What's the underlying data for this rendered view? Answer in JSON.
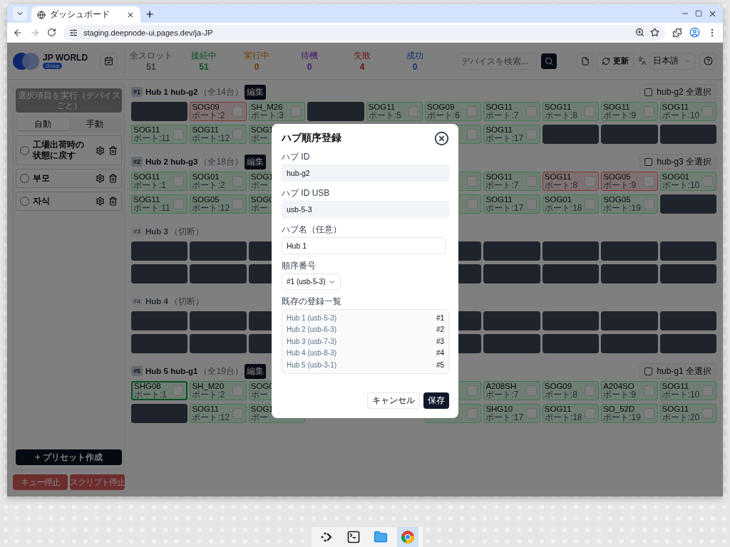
{
  "browser": {
    "tab_title": "ダッシュボード",
    "url": "staging.deepnode-ui.pages.dev/ja-JP"
  },
  "header": {
    "brand": "JP WORLD",
    "brand_badge": "Group",
    "stats": [
      {
        "kind": "total",
        "label": "全スロット",
        "value": "51"
      },
      {
        "kind": "connected",
        "label": "接続中",
        "value": "51"
      },
      {
        "kind": "running",
        "label": "実行中",
        "value": "0"
      },
      {
        "kind": "waiting",
        "label": "待機",
        "value": "0"
      },
      {
        "kind": "failed",
        "label": "失敗",
        "value": "4"
      },
      {
        "kind": "success",
        "label": "成功",
        "value": "0"
      }
    ],
    "search": {
      "placeholder": "デバイスを検索..."
    },
    "refresh": "更新",
    "language": "日本語"
  },
  "sidebar": {
    "run_button": "選択項目を実行（デバイスごと）",
    "modes": [
      {
        "label": "自動",
        "selected": true
      },
      {
        "label": "手動",
        "selected": false
      }
    ],
    "presets": [
      {
        "name": "工場出荷時の状態に戻す",
        "selected": false
      },
      {
        "name": "부모",
        "selected": false
      },
      {
        "name": "자식",
        "selected": false
      }
    ],
    "create_button": "+ プリセット作成",
    "stop_buttons": [
      "キュー停止",
      "スクリプト停止"
    ]
  },
  "hubs": [
    {
      "badge": "#1",
      "title": "Hub 1 hub-g2",
      "note": "（全14台）",
      "connected": true,
      "edit": "編集",
      "select_all": {
        "label": "hub-g2 全選択",
        "checked": false
      },
      "rows": [
        [
          {
            "kind": "empty"
          },
          {
            "kind": "device",
            "failed": true,
            "name": "SOG09",
            "port": "ポート:2",
            "highlighted": false
          },
          {
            "kind": "device",
            "failed": false,
            "name": "SH_M26",
            "port": "ポート:3",
            "highlighted": false
          },
          {
            "kind": "empty"
          },
          {
            "kind": "device",
            "failed": false,
            "name": "SOG11",
            "port": "ポート:5",
            "highlighted": false
          },
          {
            "kind": "device",
            "failed": false,
            "name": "SOG09",
            "port": "ポート:6",
            "highlighted": false
          },
          {
            "kind": "device",
            "failed": false,
            "name": "SOG11",
            "port": "ポート:7",
            "highlighted": false
          },
          {
            "kind": "device",
            "failed": false,
            "name": "SOG11",
            "port": "ポート:8",
            "highlighted": false
          },
          {
            "kind": "device",
            "failed": false,
            "name": "SOG11",
            "port": "ポート:9",
            "highlighted": false
          },
          {
            "kind": "device",
            "failed": false,
            "name": "SOG11",
            "port": "ポート:10",
            "highlighted": false
          }
        ],
        [
          {
            "kind": "device",
            "failed": false,
            "name": "SOG11",
            "port": "ポート:11",
            "highlighted": false
          },
          {
            "kind": "device",
            "failed": false,
            "name": "SOG11",
            "port": "ポート:12",
            "highlighted": false
          },
          {
            "kind": "device_left",
            "failed": false,
            "name": "SOG1",
            "port": "ポー",
            "highlighted": false
          },
          {
            "kind": "covered"
          },
          {
            "kind": "covered"
          },
          {
            "kind": "device",
            "failed": false,
            "highlighted": false
          },
          {
            "kind": "device",
            "failed": false,
            "name": "SOG11",
            "port": "ポート:17",
            "highlighted": false
          },
          {
            "kind": "empty"
          },
          {
            "kind": "empty"
          },
          {
            "kind": "empty"
          }
        ]
      ]
    },
    {
      "badge": "#2",
      "title": "Hub 2 hub-g3",
      "note": "（全18台）",
      "connected": true,
      "edit": "編集",
      "select_all": {
        "label": "hub-g3 全選択",
        "checked": false
      },
      "rows": [
        [
          {
            "kind": "device",
            "failed": false,
            "name": "SOG11",
            "port": "ポート:1",
            "highlighted": false
          },
          {
            "kind": "device",
            "failed": false,
            "name": "SOG01",
            "port": "ポート:2",
            "highlighted": false
          },
          {
            "kind": "device_left",
            "failed": false,
            "name": "SOG1",
            "port": "ポー",
            "highlighted": false
          },
          {
            "kind": "covered"
          },
          {
            "kind": "covered"
          },
          {
            "kind": "device",
            "failed": false,
            "highlighted": false
          },
          {
            "kind": "device",
            "failed": false,
            "name": "SOG11",
            "port": "ポート:7",
            "highlighted": false
          },
          {
            "kind": "device",
            "failed": true,
            "name": "SOG11",
            "port": "ポート:8",
            "highlighted": false
          },
          {
            "kind": "device",
            "failed": true,
            "name": "SOG05",
            "port": "ポート:9",
            "highlighted": false
          },
          {
            "kind": "device",
            "failed": false,
            "name": "SOG01",
            "port": "ポート:10",
            "highlighted": false
          }
        ],
        [
          {
            "kind": "device",
            "failed": false,
            "name": "SOG11",
            "port": "ポート:11",
            "highlighted": false
          },
          {
            "kind": "device",
            "failed": false,
            "name": "SOG05",
            "port": "ポート:12",
            "highlighted": false
          },
          {
            "kind": "device_left",
            "failed": false,
            "name": "SOG0",
            "port": "ポー",
            "highlighted": false
          },
          {
            "kind": "covered"
          },
          {
            "kind": "covered"
          },
          {
            "kind": "device",
            "failed": false,
            "highlighted": false
          },
          {
            "kind": "device",
            "failed": false,
            "name": "SOG11",
            "port": "ポート:17",
            "highlighted": false
          },
          {
            "kind": "device",
            "failed": false,
            "name": "SOG01",
            "port": "ポート:18",
            "highlighted": false
          },
          {
            "kind": "device",
            "failed": false,
            "name": "SOG05",
            "port": "ポート:19",
            "highlighted": false
          },
          {
            "kind": "empty"
          }
        ]
      ]
    },
    {
      "badge": "#3",
      "title": "Hub 3",
      "note": "（切断）",
      "connected": false,
      "rows": [
        [
          {
            "kind": "empty"
          },
          {
            "kind": "empty"
          },
          {
            "kind": "empty"
          },
          {
            "kind": "covered"
          },
          {
            "kind": "covered"
          },
          {
            "kind": "empty"
          },
          {
            "kind": "empty"
          },
          {
            "kind": "empty"
          },
          {
            "kind": "empty"
          },
          {
            "kind": "empty"
          }
        ],
        [
          {
            "kind": "empty"
          },
          {
            "kind": "empty"
          },
          {
            "kind": "empty"
          },
          {
            "kind": "covered"
          },
          {
            "kind": "covered"
          },
          {
            "kind": "empty"
          },
          {
            "kind": "empty"
          },
          {
            "kind": "empty"
          },
          {
            "kind": "empty"
          },
          {
            "kind": "empty"
          }
        ]
      ]
    },
    {
      "badge": "#4",
      "title": "Hub 4",
      "note": "（切断）",
      "connected": false,
      "rows": [
        [
          {
            "kind": "empty"
          },
          {
            "kind": "empty"
          },
          {
            "kind": "empty"
          },
          {
            "kind": "covered"
          },
          {
            "kind": "covered"
          },
          {
            "kind": "empty"
          },
          {
            "kind": "empty"
          },
          {
            "kind": "empty"
          },
          {
            "kind": "empty"
          },
          {
            "kind": "empty"
          }
        ],
        [
          {
            "kind": "empty"
          },
          {
            "kind": "empty"
          },
          {
            "kind": "empty"
          },
          {
            "kind": "covered"
          },
          {
            "kind": "covered"
          },
          {
            "kind": "empty"
          },
          {
            "kind": "empty"
          },
          {
            "kind": "empty"
          },
          {
            "kind": "empty"
          },
          {
            "kind": "empty"
          }
        ]
      ]
    },
    {
      "badge": "#5",
      "title": "Hub 5 hub-g1",
      "note": "（全19台）",
      "connected": true,
      "edit": "編集",
      "select_all": {
        "label": "hub-g1 全選択",
        "checked": false
      },
      "rows": [
        [
          {
            "kind": "device",
            "failed": false,
            "name": "SHG08",
            "port": "ポート:1",
            "highlighted": true
          },
          {
            "kind": "device",
            "failed": false,
            "name": "SH_M20",
            "port": "ポート:2",
            "highlighted": false
          },
          {
            "kind": "device_left",
            "failed": false,
            "name": "SOG0",
            "port": "ポー",
            "highlighted": false
          },
          {
            "kind": "covered"
          },
          {
            "kind": "covered"
          },
          {
            "kind": "device",
            "failed": false,
            "highlighted": false
          },
          {
            "kind": "device",
            "failed": false,
            "name": "A208SH",
            "port": "ポート:7",
            "highlighted": false
          },
          {
            "kind": "device",
            "failed": false,
            "name": "SOG09",
            "port": "ポート:8",
            "highlighted": false
          },
          {
            "kind": "device",
            "failed": false,
            "name": "A204SO",
            "port": "ポート:9",
            "highlighted": false
          },
          {
            "kind": "device",
            "failed": false,
            "name": "SOG11",
            "port": "ポート:10",
            "highlighted": false
          }
        ],
        [
          {
            "kind": "empty"
          },
          {
            "kind": "device",
            "failed": false,
            "name": "SOG11",
            "port": "ポート:12",
            "highlighted": false
          },
          {
            "kind": "device_left",
            "failed": false,
            "name": "SOG1",
            "port": "ポー",
            "highlighted": false
          },
          {
            "kind": "covered"
          },
          {
            "kind": "covered"
          },
          {
            "kind": "device",
            "failed": false,
            "highlighted": false
          },
          {
            "kind": "device",
            "failed": false,
            "name": "SHG10",
            "port": "ポート:17",
            "highlighted": false
          },
          {
            "kind": "device",
            "failed": false,
            "name": "SOG11",
            "port": "ポート:18",
            "highlighted": false
          },
          {
            "kind": "device",
            "failed": false,
            "name": "SO_52D",
            "port": "ポート:19",
            "highlighted": false
          },
          {
            "kind": "device",
            "failed": false,
            "name": "SOG11",
            "port": "ポート:20",
            "highlighted": false
          }
        ]
      ]
    }
  ],
  "modal": {
    "title": "ハブ順序登録",
    "fields": [
      {
        "kind": "readonly",
        "label": "ハブ ID",
        "value": "hub-g2"
      },
      {
        "kind": "readonly",
        "label": "ハブ ID USB",
        "value": "usb-5-3"
      },
      {
        "kind": "input",
        "label": "ハブ名（任意）",
        "value": "Hub 1"
      },
      {
        "kind": "select",
        "label": "順序番号",
        "value": "#1 (usb-5-3)"
      }
    ],
    "list_label": "既存の登録一覧",
    "registered": [
      {
        "name": "Hub 1 (usb-5-3)",
        "order": "#1"
      },
      {
        "name": "Hub 2 (usb-6-3)",
        "order": "#2"
      },
      {
        "name": "Hub 3 (usb-7-3)",
        "order": "#3"
      },
      {
        "name": "Hub 4 (usb-8-3)",
        "order": "#4"
      },
      {
        "name": "Hub 5 (usb-3-1)",
        "order": "#5"
      }
    ],
    "cancel": "キャンセル",
    "save": "保存"
  }
}
